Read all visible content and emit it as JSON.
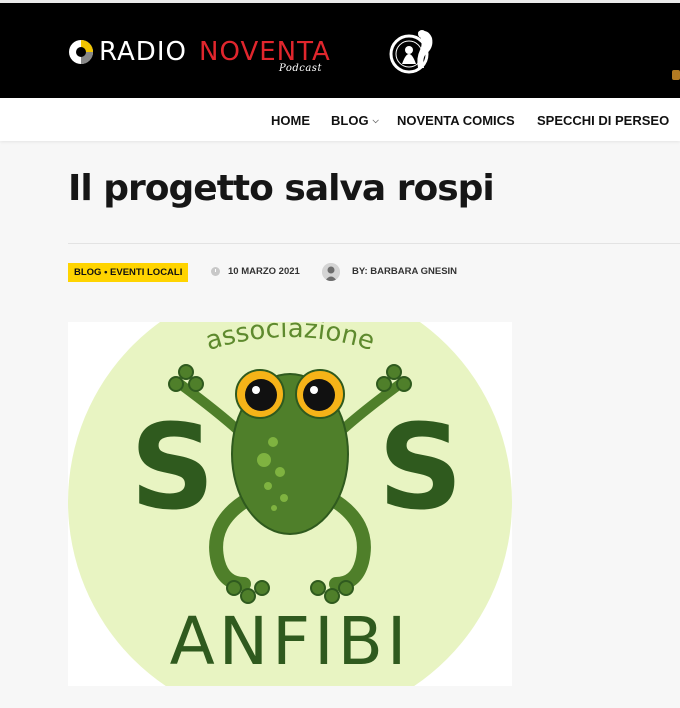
{
  "header": {
    "logo_radio": "RADIO",
    "logo_noventa": "NOVENTA",
    "logo_podcast": "Podcast"
  },
  "nav": {
    "home": "HOME",
    "blog": "BLOG",
    "comics": "NOVENTA COMICS",
    "specchi": "SPECCHI DI PERSEO"
  },
  "article": {
    "title": "Il progetto salva rospi",
    "category": "BLOG • EVENTI LOCALI",
    "date": "10 MARZO 2021",
    "author": "BY: BARBARA GNESIN"
  },
  "image": {
    "arc_text": "associazione",
    "letter_left": "S",
    "letter_right": "S",
    "bottom_text": "ANFIBI"
  },
  "colors": {
    "brand_red": "#e1262d",
    "category_yellow": "#ffd400",
    "frog_green": "#4f7f2a",
    "dark_green": "#2f5a1e",
    "circle_bg": "#e8f4c2"
  }
}
